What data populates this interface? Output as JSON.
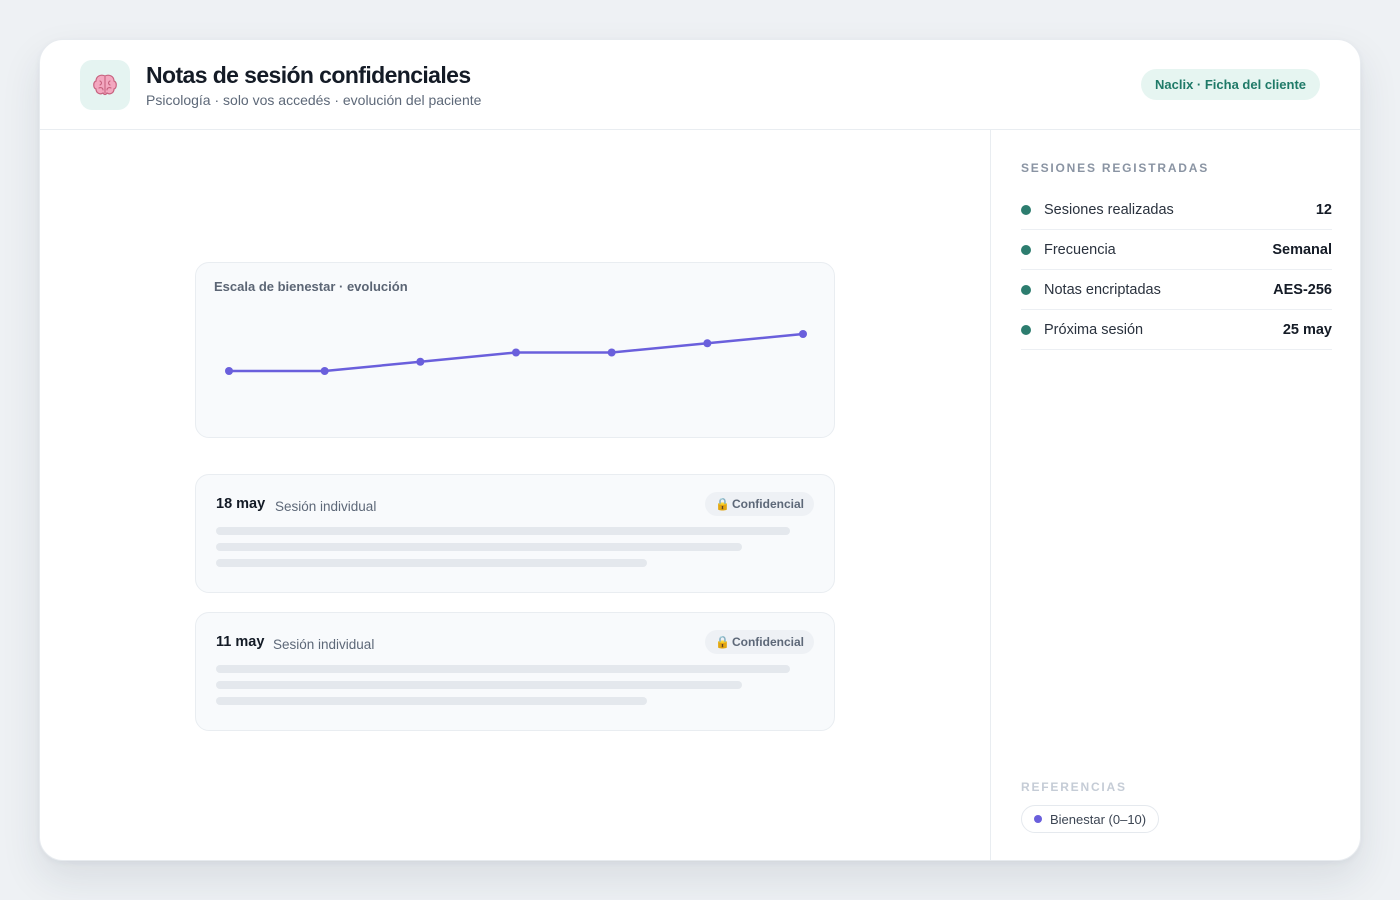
{
  "header": {
    "icon": "brain-icon",
    "title": "Notas de sesión confidenciales",
    "subtitle": "Psicología · solo vos accedés · evolución del paciente",
    "badge": "Naclix · Ficha del cliente"
  },
  "sidebar": {
    "heading": "SESIONES REGISTRADAS",
    "stats": [
      {
        "label": "Sesiones realizadas",
        "value": "12"
      },
      {
        "label": "Frecuencia",
        "value": "Semanal"
      },
      {
        "label": "Notas encriptadas",
        "value": "AES-256"
      },
      {
        "label": "Próxima sesión",
        "value": "25 may"
      }
    ],
    "references_heading": "REFERENCIAS",
    "legend": "Bienestar (0–10)"
  },
  "chart_data": {
    "type": "line",
    "title": "Escala de bienestar · evolución",
    "series": [
      {
        "name": "Bienestar (0–10)",
        "values": [
          5.0,
          5.0,
          5.5,
          6.0,
          6.0,
          6.5,
          7.0
        ]
      }
    ],
    "ylim": [
      0,
      10
    ],
    "grid": false,
    "color": "#6a5fdc"
  },
  "sessions": [
    {
      "date": "18 may",
      "type": "Sesión individual",
      "badge": "Confidencial"
    },
    {
      "date": "11 may",
      "type": "Sesión individual",
      "badge": "Confidencial"
    }
  ],
  "colors": {
    "accent": "#2d7d6f",
    "chart_line": "#6a5fdc",
    "badge_bg": "#e6f5f1"
  }
}
